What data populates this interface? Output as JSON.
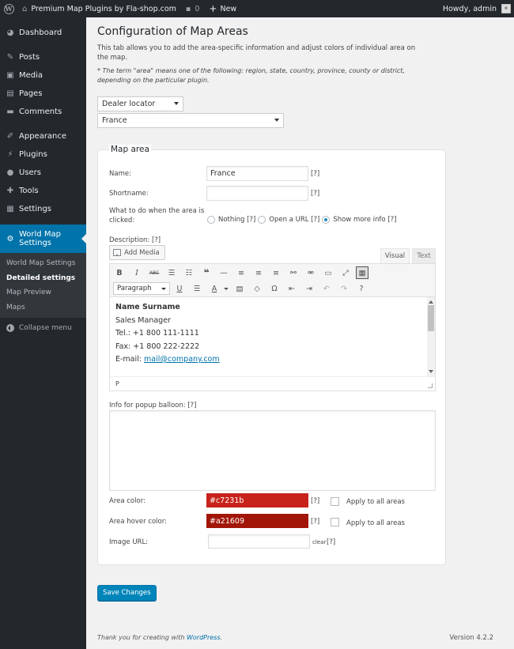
{
  "adminbar": {
    "site_name": "Premium Map Plugins by Fla-shop.com",
    "comments_count": "0",
    "new_label": "New",
    "howdy": "Howdy, admin"
  },
  "sidebar": {
    "items": [
      {
        "label": "Dashboard",
        "icon": "dashboard-icon"
      },
      {
        "label": "Posts",
        "icon": "pin-icon"
      },
      {
        "label": "Media",
        "icon": "media-icon"
      },
      {
        "label": "Pages",
        "icon": "pages-icon"
      },
      {
        "label": "Comments",
        "icon": "comment-icon"
      },
      {
        "label": "Appearance",
        "icon": "brush-icon"
      },
      {
        "label": "Plugins",
        "icon": "plugin-icon"
      },
      {
        "label": "Users",
        "icon": "user-icon"
      },
      {
        "label": "Tools",
        "icon": "wrench-icon"
      },
      {
        "label": "Settings",
        "icon": "settings-icon"
      }
    ],
    "current": {
      "label": "World Map Settings",
      "icon": "gear-icon"
    },
    "submenu": [
      "World Map Settings",
      "Detailed settings",
      "Map Preview",
      "Maps"
    ],
    "collapse_label": "Collapse menu"
  },
  "page": {
    "title": "Configuration of Map Areas",
    "intro": "This tab allows you to add the area-specific information and adjust colors of individual area on the map.",
    "note": "* The term \"area\" means one of the following: region, state, country, province, county or district, depending on the particular plugin.",
    "plugin_select": "Dealer locator",
    "area_select": "France"
  },
  "map_area": {
    "title": "Map area",
    "name_label": "Name:",
    "name_value": "France",
    "shortname_label": "Shortname:",
    "shortname_value": "",
    "help": "[?]",
    "click_label": "What to do when the area is clicked:",
    "click_options": [
      "Nothing [?]",
      "Open a URL [?]",
      "Show more info [?]"
    ],
    "description_label": "Description: [?]",
    "add_media": "Add Media",
    "tab_visual": "Visual",
    "tab_text": "Text",
    "format_select": "Paragraph",
    "content": {
      "name": "Name Surname",
      "title": "Sales Manager",
      "tel": "Tel.: +1 800 111-1111",
      "fax": "Fax: +1 800 222-2222",
      "email_label": "E-mail: ",
      "email": "mail@company.com"
    },
    "status_path": "P",
    "popup_label": "Info for popup balloon: [?]",
    "area_color_label": "Area color:",
    "area_color": "#c7231b",
    "hover_color_label": "Area hover color:",
    "hover_color": "#a21609",
    "apply_all": "Apply to all areas",
    "image_url_label": "Image URL:",
    "clear": "clear"
  },
  "save_button": "Save Changes",
  "footer": {
    "thanks_prefix": "Thank you for creating with ",
    "wordpress": "WordPress",
    "thanks_suffix": ".",
    "version": "Version 4.2.2"
  }
}
